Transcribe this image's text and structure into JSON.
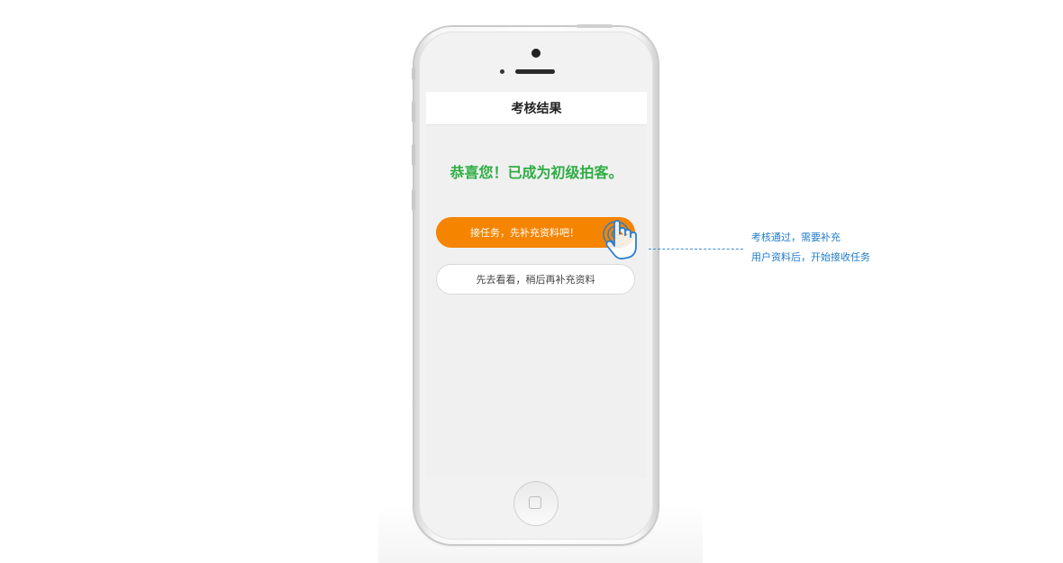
{
  "screen": {
    "title": "考核结果",
    "message": "恭喜您！已成为初级拍客。",
    "primary_button": "接任务，先补充资料吧！",
    "secondary_button": "先去看看，稍后再补充资料"
  },
  "annotation": {
    "line1": "考核通过，需要补充",
    "line2": "用户资料后，开始接收任务"
  },
  "colors": {
    "accent_orange": "#f58400",
    "success_green": "#2fae43",
    "annotation_blue": "#1f7bc9"
  },
  "icons": {
    "tap_gesture": "hand-tap-icon",
    "home": "home-button-icon"
  }
}
